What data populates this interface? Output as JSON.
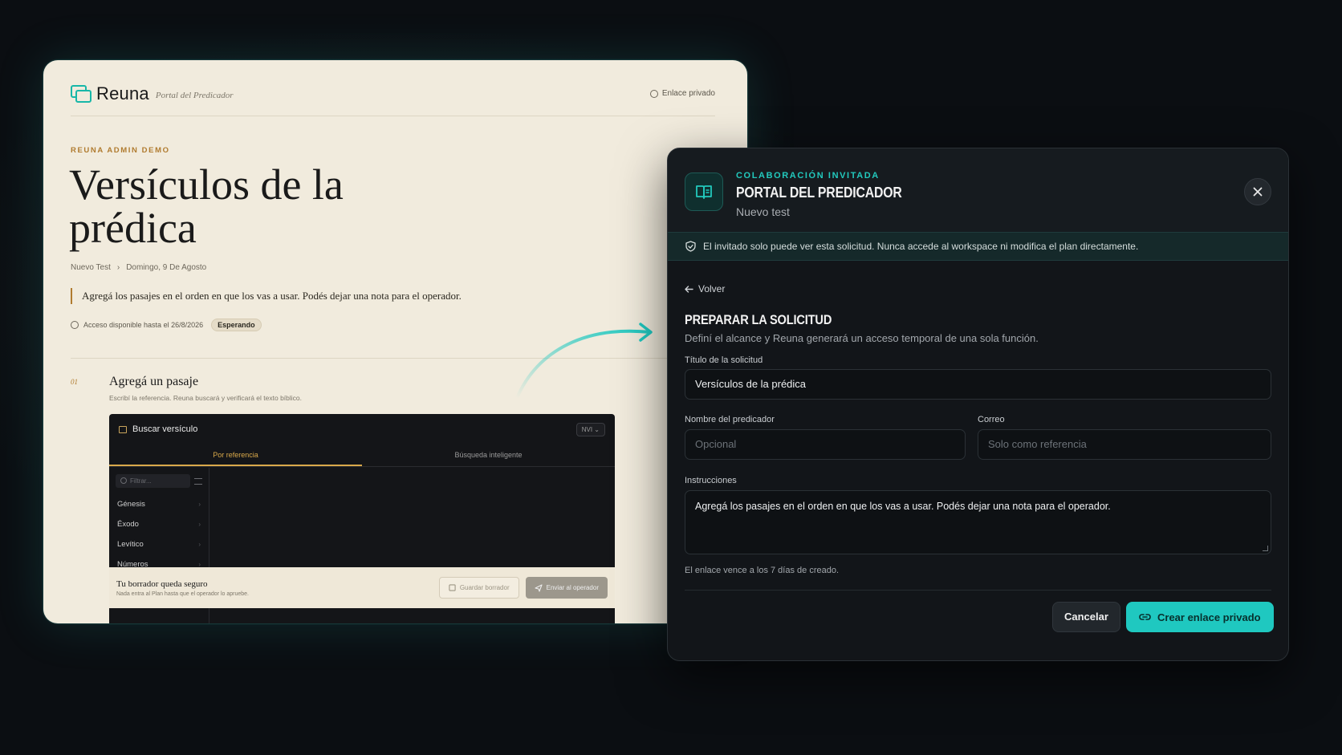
{
  "portal": {
    "brand": "Reuna",
    "brand_sub": "Portal del Predicador",
    "private_link": "Enlace privado",
    "eyebrow": "REUNA ADMIN DEMO",
    "title": "Versículos de la prédica",
    "crumb_1": "Nuevo Test",
    "crumb_sep": "›",
    "crumb_2": "Domingo, 9 De Agosto",
    "instructions": "Agregá los pasajes en el orden en que los vas a usar. Podés dejar una nota para el operador.",
    "access": "Acceso disponible hasta el 26/8/2026",
    "status": "Esperando",
    "step_num": "01",
    "step_title": "Agregá un pasaje",
    "step_sub": "Escribí la referencia. Reuna buscará y verificará el texto bíblico.",
    "searcher": {
      "title": "Buscar versículo",
      "version": "NVI ⌄",
      "tab_ref": "Por referencia",
      "tab_smart": "Búsqueda inteligente",
      "filter_placeholder": "Filtrar...",
      "books": [
        "Génesis",
        "Éxodo",
        "Levítico",
        "Números"
      ]
    },
    "footer": {
      "title": "Tu borrador queda seguro",
      "sub": "Nada entra al Plan hasta que el operador lo apruebe.",
      "save_draft": "Guardar borrador",
      "send": "Enviar al operador"
    }
  },
  "modal": {
    "eyebrow": "COLABORACIÓN INVITADA",
    "title": "PORTAL DEL PREDICADOR",
    "subtitle": "Nuevo test",
    "notice": "El invitado solo puede ver esta solicitud. Nunca accede al workspace ni modifica el plan directamente.",
    "back": "Volver",
    "section_title": "PREPARAR LA SOLICITUD",
    "section_sub": "Definí el alcance y Reuna generará un acceso temporal de una sola función.",
    "fields": {
      "title_label": "Título de la solicitud",
      "title_value": "Versículos de la prédica",
      "preacher_label": "Nombre del predicador",
      "preacher_placeholder": "Opcional",
      "email_label": "Correo",
      "email_placeholder": "Solo como referencia",
      "instructions_label": "Instrucciones",
      "instructions_value": "Agregá los pasajes en el orden en que los vas a usar. Podés dejar una nota para el operador."
    },
    "expiry": "El enlace vence a los 7 días de creado.",
    "cancel": "Cancelar",
    "create": "Crear enlace privado"
  },
  "colors": {
    "accent": "#1fc8c0",
    "gold": "#b07b2f",
    "paper": "#f1ebdd",
    "modal_bg": "#121519"
  }
}
